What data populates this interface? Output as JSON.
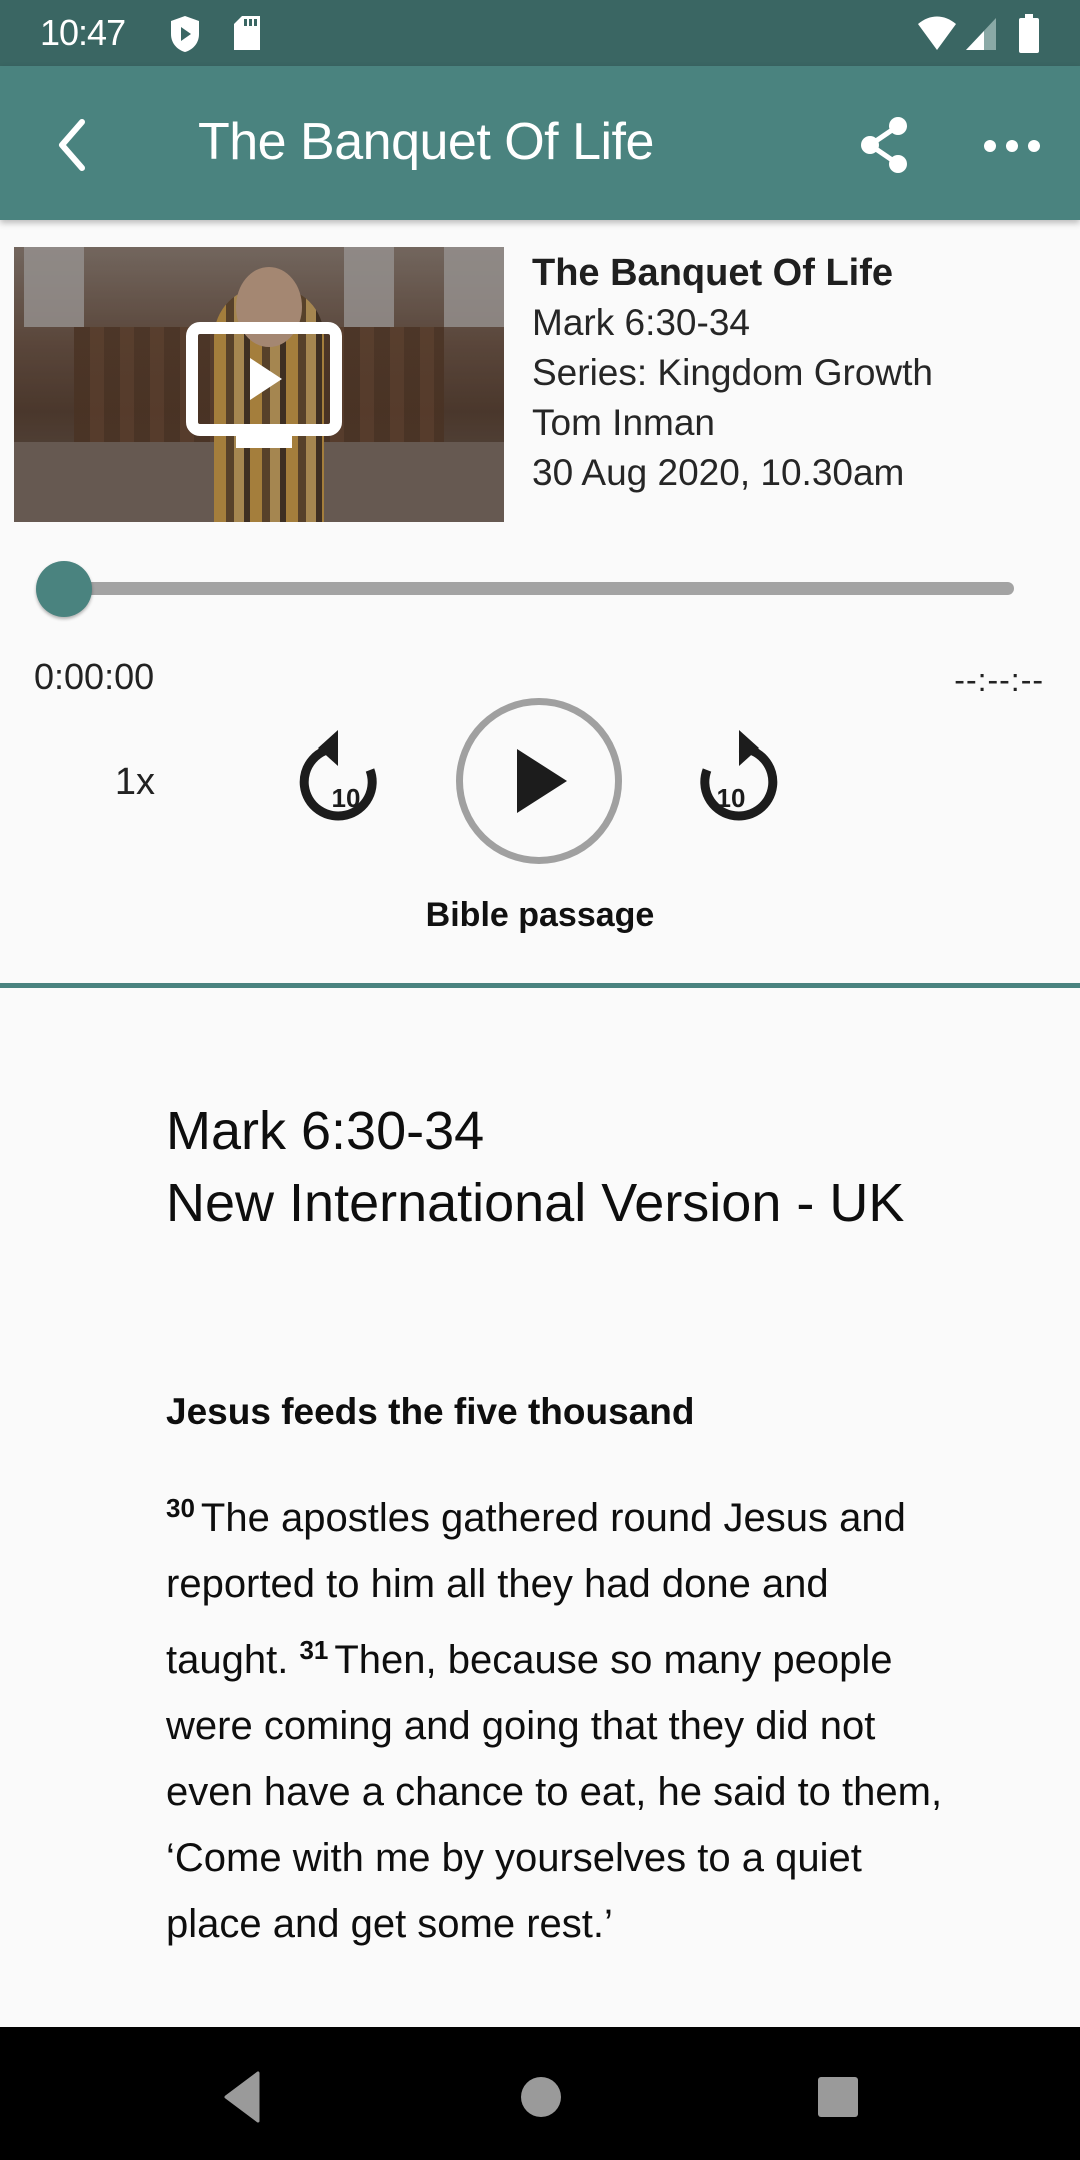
{
  "status_bar": {
    "time": "10:47",
    "left_icons": [
      "shield-play-icon",
      "sd-card-icon"
    ],
    "right_icons": [
      "wifi-icon",
      "cell-signal-icon",
      "battery-icon"
    ]
  },
  "app_bar": {
    "title": "The Banquet Of Life",
    "back_icon": "back-chevron-icon",
    "actions": [
      "share-icon",
      "more-horizontal-icon"
    ]
  },
  "sermon": {
    "thumbnail_icon": "video-play-icon",
    "title": "The Banquet Of Life",
    "passage": "Mark 6:30-34",
    "series": "Series: Kingdom Growth",
    "speaker": "Tom Inman",
    "date": "30 Aug 2020, 10.30am"
  },
  "player": {
    "progress_fraction": 0.0,
    "accent_color": "#4a837f",
    "current_time": "0:00:00",
    "total_time": "--:--:--",
    "speed": "1x",
    "rewind_seconds": "10",
    "forward_seconds": "10",
    "play_icon": "play-icon"
  },
  "tabs": {
    "active": "Bible passage"
  },
  "bible": {
    "reference": "Mark 6:30-34",
    "version": "New International Version - UK",
    "section_heading": "Jesus feeds the five thousand",
    "verses": [
      {
        "number": "30",
        "text": "The apostles gathered round Jesus and reported to him all they had done and taught."
      },
      {
        "number": "31",
        "text": "Then, because so many people were coming and going that they did not even have a chance to eat, he said to them, ‘Come with me by yourselves to a quiet place and get some rest.’"
      }
    ]
  },
  "nav_bar": {
    "buttons": [
      "back-triangle-icon",
      "home-circle-icon",
      "recents-square-icon"
    ]
  }
}
